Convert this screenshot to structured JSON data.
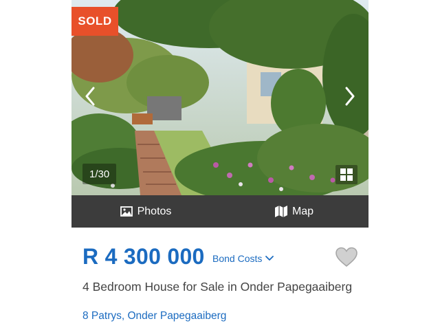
{
  "gallery": {
    "status_badge": "SOLD",
    "counter": "1/30",
    "prev_icon": "chevron-left-icon",
    "next_icon": "chevron-right-icon",
    "grid_icon": "grid-icon"
  },
  "media_bar": {
    "photos_label": "Photos",
    "photos_icon": "image-icon",
    "map_label": "Map",
    "map_icon": "map-icon"
  },
  "listing": {
    "price": "R 4 300 000",
    "bond_costs_label": "Bond Costs",
    "bond_costs_icon": "chevron-down-icon",
    "favorite_icon": "heart-icon",
    "title": "4 Bedroom House for Sale in Onder Papegaaiberg",
    "address": "8 Patrys, Onder Papegaaiberg"
  },
  "colors": {
    "accent_blue": "#1b6bc0",
    "sold_orange": "#e8502a",
    "media_bar_bg": "#3c3c3c",
    "text_gray": "#444444"
  }
}
